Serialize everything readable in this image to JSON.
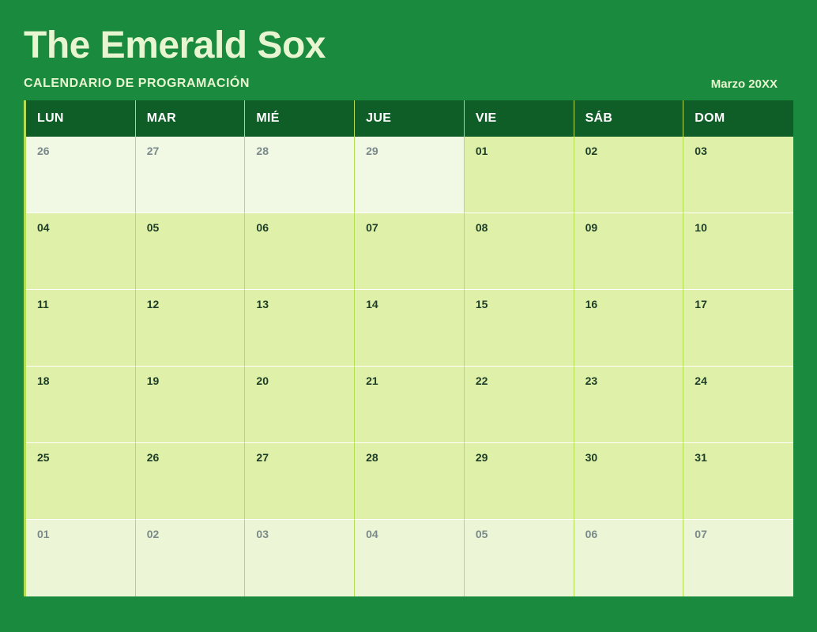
{
  "header": {
    "title": "The Emerald Sox",
    "subtitle": "CALENDARIO DE PROGRAMACIÓN",
    "month_year": "Marzo  20XX"
  },
  "days": {
    "mon": "LUN",
    "tue": "MAR",
    "wed": "MIÉ",
    "thu": "JUE",
    "fri": "VIE",
    "sat": "SÁB",
    "sun": "DOM"
  },
  "weeks": [
    [
      {
        "num": "26",
        "current": false
      },
      {
        "num": "27",
        "current": false
      },
      {
        "num": "28",
        "current": false
      },
      {
        "num": "29",
        "current": false
      },
      {
        "num": "01",
        "current": true
      },
      {
        "num": "02",
        "current": true
      },
      {
        "num": "03",
        "current": true
      }
    ],
    [
      {
        "num": "04",
        "current": true
      },
      {
        "num": "05",
        "current": true
      },
      {
        "num": "06",
        "current": true
      },
      {
        "num": "07",
        "current": true
      },
      {
        "num": "08",
        "current": true
      },
      {
        "num": "09",
        "current": true
      },
      {
        "num": "10",
        "current": true
      }
    ],
    [
      {
        "num": "11",
        "current": true
      },
      {
        "num": "12",
        "current": true
      },
      {
        "num": "13",
        "current": true
      },
      {
        "num": "14",
        "current": true
      },
      {
        "num": "15",
        "current": true
      },
      {
        "num": "16",
        "current": true
      },
      {
        "num": "17",
        "current": true
      }
    ],
    [
      {
        "num": "18",
        "current": true
      },
      {
        "num": "19",
        "current": true
      },
      {
        "num": "20",
        "current": true
      },
      {
        "num": "21",
        "current": true
      },
      {
        "num": "22",
        "current": true
      },
      {
        "num": "23",
        "current": true
      },
      {
        "num": "24",
        "current": true
      }
    ],
    [
      {
        "num": "25",
        "current": true
      },
      {
        "num": "26",
        "current": true
      },
      {
        "num": "27",
        "current": true
      },
      {
        "num": "28",
        "current": true
      },
      {
        "num": "29",
        "current": true
      },
      {
        "num": "30",
        "current": true
      },
      {
        "num": "31",
        "current": true
      }
    ],
    [
      {
        "num": "01",
        "current": false
      },
      {
        "num": "02",
        "current": false
      },
      {
        "num": "03",
        "current": false
      },
      {
        "num": "04",
        "current": false
      },
      {
        "num": "05",
        "current": false
      },
      {
        "num": "06",
        "current": false
      },
      {
        "num": "07",
        "current": false
      }
    ]
  ]
}
